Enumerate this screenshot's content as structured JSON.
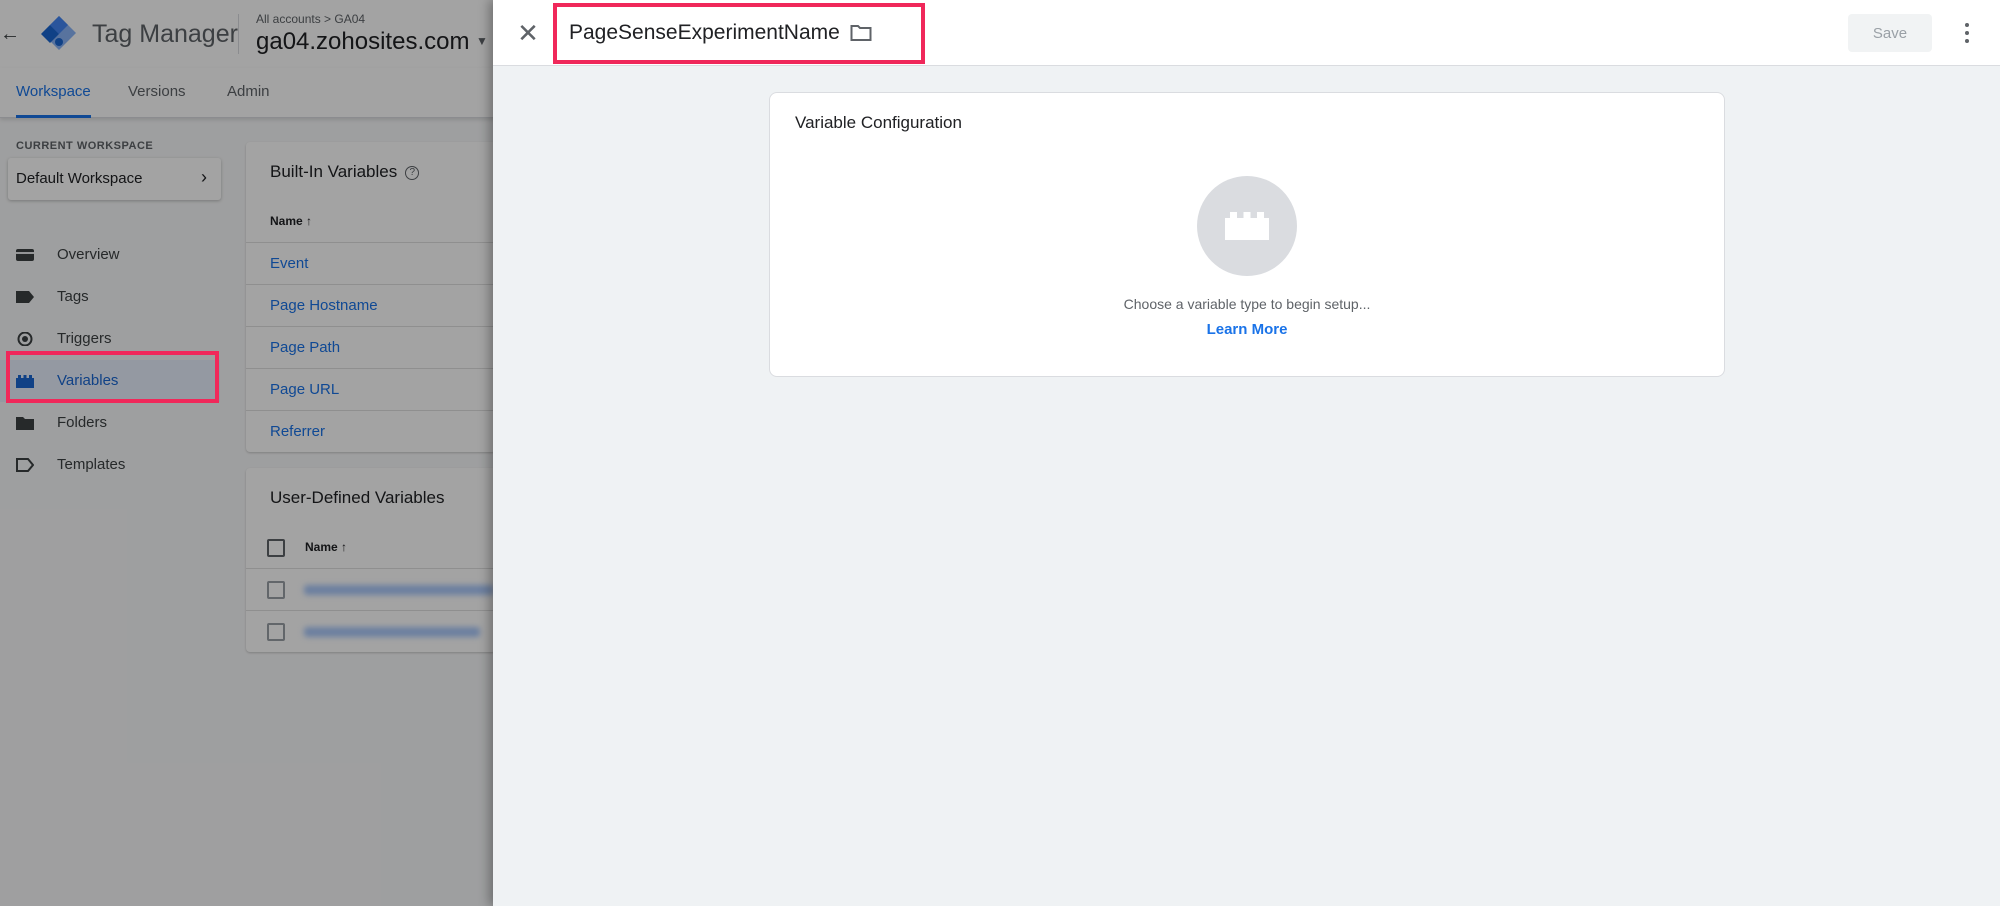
{
  "app": {
    "product_name": "Tag Manager",
    "breadcrumb": "All accounts > GA04",
    "container_name": "ga04.zohosites.com"
  },
  "tabs": [
    {
      "label": "Workspace",
      "active": true
    },
    {
      "label": "Versions",
      "active": false
    },
    {
      "label": "Admin",
      "active": false
    }
  ],
  "workspace": {
    "section_label": "CURRENT WORKSPACE",
    "name": "Default Workspace"
  },
  "nav": [
    {
      "label": "Overview",
      "icon": "overview-icon"
    },
    {
      "label": "Tags",
      "icon": "tag-icon"
    },
    {
      "label": "Triggers",
      "icon": "trigger-icon"
    },
    {
      "label": "Variables",
      "icon": "variables-icon",
      "active": true
    },
    {
      "label": "Folders",
      "icon": "folder-icon"
    },
    {
      "label": "Templates",
      "icon": "template-icon"
    }
  ],
  "builtin": {
    "title": "Built-In Variables",
    "col_name": "Name",
    "rows": [
      "Event",
      "Page Hostname",
      "Page Path",
      "Page URL",
      "Referrer"
    ]
  },
  "userdef": {
    "title": "User-Defined Variables",
    "col_name": "Name"
  },
  "sheet": {
    "variable_name": "PageSenseExperimentName",
    "save_label": "Save",
    "config_title": "Variable Configuration",
    "choose_text": "Choose a variable type to begin setup...",
    "learn_more": "Learn More"
  },
  "colors": {
    "accent": "#1a73e8",
    "highlight": "#f0285a"
  }
}
